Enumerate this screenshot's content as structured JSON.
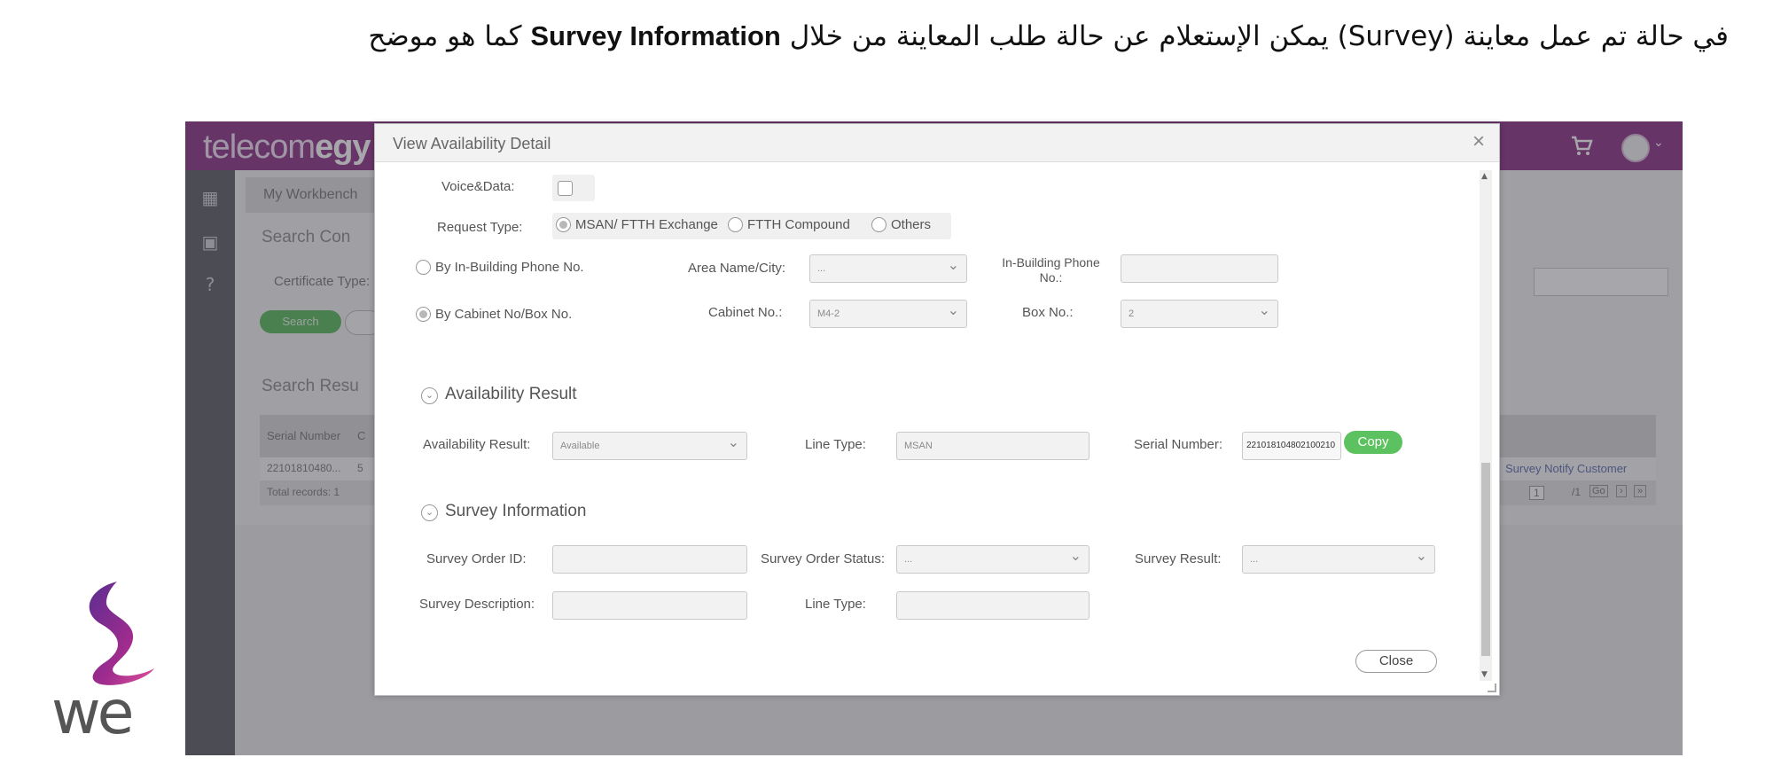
{
  "slide": {
    "caption_part1": "في حالة تم عمل معاينة (Survey) يمكن الإستعلام عن حالة طلب المعاينة من خلال ",
    "caption_bold": "Survey Information",
    "caption_part2": " كما هو موضح"
  },
  "app": {
    "brand_light": "telecom",
    "brand_bold": "egy",
    "tab_workbench": "My Workbench",
    "search_conditions": "Search Con",
    "certificate_type": "Certificate Type:",
    "search_button": "Search",
    "search_results": "Search Resu",
    "col_serial": "Serial Number",
    "col_next": "C",
    "row_serial": "22101810480...",
    "row_next": "5",
    "total_records": "Total records: 1",
    "survey_notify_link": "Survey Notify Customer",
    "pager_page": "1",
    "pager_total": "/1",
    "pager_go": "Go"
  },
  "modal": {
    "title": "View Availability Detail",
    "close_x": "×",
    "voice_data_label": "Voice&Data:",
    "request_type_label": "Request Type:",
    "request_types": [
      "MSAN/ FTTH Exchange",
      "FTTH Compound",
      "Others"
    ],
    "by_inbuilding_phone": "By In-Building Phone No.",
    "area_name_label": "Area Name/City:",
    "area_name_value": "...",
    "inbuilding_phone_label_line1": "In-Building Phone",
    "inbuilding_phone_label_line2": "No.:",
    "by_cabinet_box": "By Cabinet No/Box No.",
    "cabinet_label": "Cabinet No.:",
    "cabinet_value": "M4-2",
    "box_label": "Box No.:",
    "box_value": "2",
    "availability_section": "Availability Result",
    "availability_result_label": "Availability Result:",
    "availability_result_value": "Available",
    "line_type_label": "Line Type:",
    "line_type_value": "MSAN",
    "serial_number_label": "Serial Number:",
    "serial_number_value": "221018104802100210",
    "copy_button": "Copy",
    "survey_section": "Survey Information",
    "survey_order_id_label": "Survey Order ID:",
    "survey_order_status_label": "Survey Order Status:",
    "survey_order_status_value": "...",
    "survey_result_label": "Survey Result:",
    "survey_result_value": "...",
    "survey_description_label": "Survey Description:",
    "survey_line_type_label": "Line Type:",
    "close_button": "Close"
  },
  "logo": {
    "text": "we"
  },
  "colors": {
    "brand_purple": "#8b2f86",
    "copy_green": "#5cc15f",
    "search_green": "#57b85a"
  }
}
